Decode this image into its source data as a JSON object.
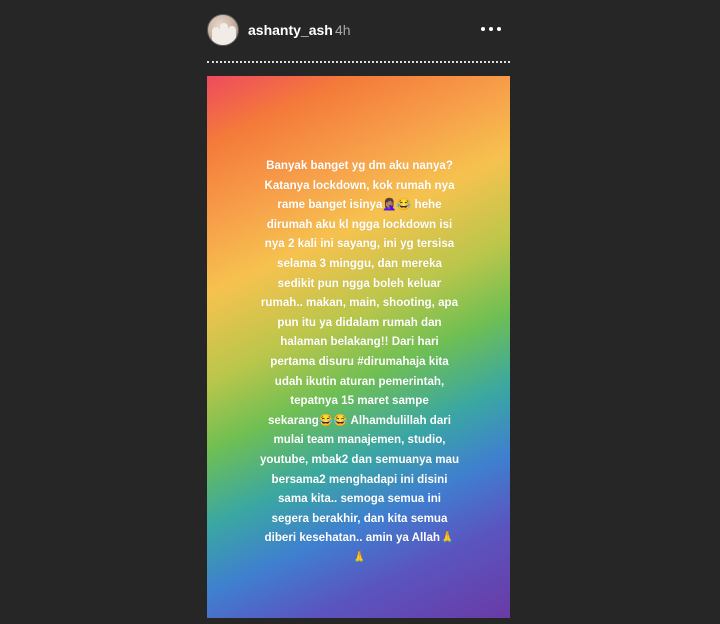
{
  "header": {
    "username": "ashanty_ash",
    "time": "4h",
    "avatar_icon": "profile-avatar",
    "more_icon": "more-options-icon"
  },
  "story": {
    "text": "Banyak banget yg dm aku nanya?\nKatanya lockdown, kok rumah nya\nrame banget isinya🤦🏽‍♀️😂 hehe\ndirumah aku kl ngga lockdown isi\nnya 2 kali ini sayang, ini yg tersisa\nselama 3 minggu, dan mereka\nsedikit pun ngga boleh keluar\nrumah.. makan, main, shooting, apa\npun itu ya didalam rumah dan\nhalaman belakang!! Dari hari\npertama disuru #dirumahaja kita\nudah ikutin aturan pemerintah,\ntepatnya 15 maret sampe\nsekarang😂😂  Alhamdulillah dari\nmulai team manajemen, studio,\nyoutube, mbak2 dan semuanya mau\nbersama2 menghadapi ini disini\nsama kita.. semoga semua ini\nsegera berakhir, dan kita semua\ndiberi kesehatan.. amin ya Allah🙏\n🙏"
  }
}
